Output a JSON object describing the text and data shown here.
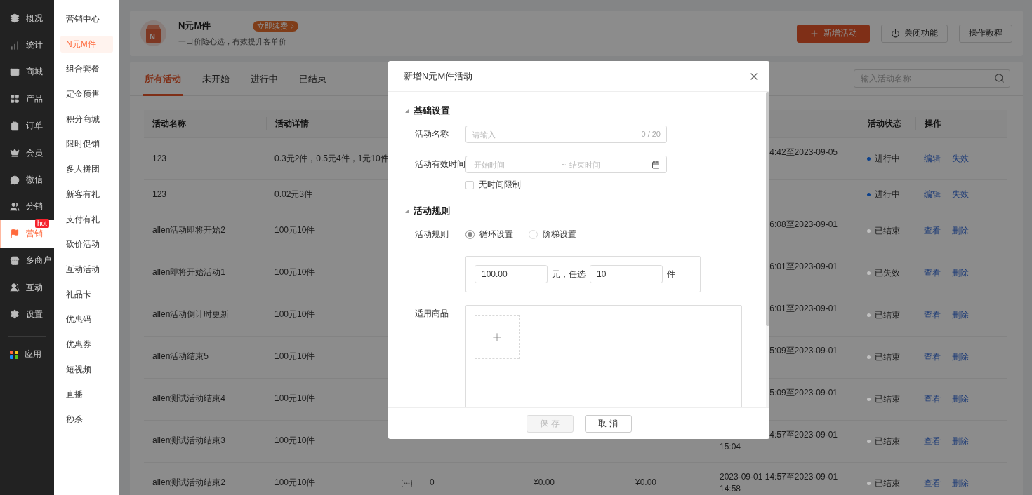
{
  "nav": {
    "items": [
      {
        "label": "概况",
        "selected": false
      },
      {
        "label": "统计",
        "selected": false
      },
      {
        "label": "商城",
        "selected": false
      },
      {
        "label": "产品",
        "selected": false
      },
      {
        "label": "订单",
        "selected": false
      },
      {
        "label": "会员",
        "selected": false
      },
      {
        "label": "微信",
        "selected": false
      },
      {
        "label": "分销",
        "selected": false
      },
      {
        "label": "营销",
        "selected": true,
        "badge": "hot"
      },
      {
        "label": "多商户",
        "selected": false
      },
      {
        "label": "互动",
        "selected": false
      },
      {
        "label": "设置",
        "selected": false
      }
    ],
    "apps": [
      {
        "label": "应用",
        "selected": false
      }
    ]
  },
  "submenu": {
    "items": [
      {
        "label": "营销中心",
        "selected": false
      },
      {
        "label": "N元M件",
        "selected": true
      },
      {
        "label": "组合套餐",
        "selected": false
      },
      {
        "label": "定金预售",
        "selected": false
      },
      {
        "label": "积分商城",
        "selected": false
      },
      {
        "label": "限时促销",
        "selected": false
      },
      {
        "label": "多人拼团",
        "selected": false
      },
      {
        "label": "新客有礼",
        "selected": false
      },
      {
        "label": "支付有礼",
        "selected": false
      },
      {
        "label": "砍价活动",
        "selected": false
      },
      {
        "label": "互动活动",
        "selected": false
      },
      {
        "label": "礼品卡",
        "selected": false
      },
      {
        "label": "优惠码",
        "selected": false
      },
      {
        "label": "优惠券",
        "selected": false
      },
      {
        "label": "短视频",
        "selected": false
      },
      {
        "label": "直播",
        "selected": false
      },
      {
        "label": "秒杀",
        "selected": false
      }
    ]
  },
  "header": {
    "logo_letter": "N",
    "title": "N元M件",
    "renew": "立即续费",
    "subtitle": "一口价随心选，有效提升客单价",
    "buttons": [
      {
        "label": "新增活动",
        "kind": "primary"
      },
      {
        "label": "关闭功能",
        "kind": "power"
      },
      {
        "label": "操作教程",
        "kind": "plain"
      }
    ]
  },
  "tabs": [
    {
      "label": "所有活动",
      "selected": true
    },
    {
      "label": "未开始",
      "selected": false
    },
    {
      "label": "进行中",
      "selected": false
    },
    {
      "label": "已结束",
      "selected": false
    }
  ],
  "search": {
    "placeholder": "输入活动名称"
  },
  "table": {
    "columns": {
      "name": "活动名称",
      "detail": "活动详情",
      "status": "活动状态",
      "actions": "操作"
    },
    "rows": [
      {
        "kind": "partial",
        "name": "123",
        "detail": "0.3元2件，0.5元4件，1元10件",
        "column_7": [
          "4:42至2023-09-05"
        ],
        "status": {
          "label": "进行中",
          "color": "#0c418c"
        },
        "actions": [
          "编辑",
          "失效"
        ]
      },
      {
        "kind": "partial",
        "name": "123",
        "detail": "0.02元3件",
        "status": {
          "label": "进行中",
          "color": "#0c418c"
        },
        "actions": [
          "编辑",
          "失效"
        ]
      },
      {
        "kind": "partial",
        "name": "allen活动即将开始2",
        "detail": "100元10件",
        "column_7": [
          "6:08至2023-09-01"
        ],
        "status": {
          "label": "已结束",
          "color": "#c0c0c0"
        },
        "actions": [
          "查看",
          "删除"
        ]
      },
      {
        "kind": "partial",
        "name": "allen即将开始活动1",
        "detail": "100元10件",
        "column_7": [
          "6:01至2023-09-01"
        ],
        "status": {
          "label": "已失效",
          "color": "#c0c0c0"
        },
        "actions": [
          "查看",
          "删除"
        ]
      },
      {
        "kind": "partial",
        "name": "allen活动倒计时更新",
        "detail": "100元10件",
        "column_7": [
          "6:01至2023-09-01"
        ],
        "status": {
          "label": "已结束",
          "color": "#c0c0c0"
        },
        "actions": [
          "查看",
          "删除"
        ]
      },
      {
        "kind": "partial",
        "name": "allen活动结束5",
        "detail": "100元10件",
        "column_7": [
          "5:09至2023-09-01"
        ],
        "status": {
          "label": "已结束",
          "color": "#c0c0c0"
        },
        "actions": [
          "查看",
          "删除"
        ]
      },
      {
        "kind": "partial",
        "name": "allen测试活动结束4",
        "detail": "100元10件",
        "column_7": [
          "5:09至2023-09-01"
        ],
        "status": {
          "label": "已结束",
          "color": "#c0c0c0"
        },
        "actions": [
          "查看",
          "删除"
        ]
      },
      {
        "kind": "partial",
        "name": "allen测试活动结束3",
        "detail": "100元10件",
        "column_7": [
          "4:57至2023-09-01",
          "15:04"
        ],
        "status": {
          "label": "已结束",
          "color": "#c0c0c0"
        },
        "actions": [
          "查看",
          "删除"
        ]
      },
      {
        "kind": "full",
        "name": "allen测试活动结束2",
        "detail": "100元10件",
        "column_4": "0",
        "column_5": "¥0.00",
        "column_6": "¥0.00",
        "column_7": [
          "2023-09-01 14:57至2023-09-01",
          "14:58"
        ],
        "status": {
          "label": "已结束",
          "color": "#c0c0c0"
        },
        "actions": [
          "查看",
          "删除"
        ]
      }
    ]
  },
  "modal": {
    "title": "新增N元M件活动",
    "sections": [
      {
        "title": "基础设置",
        "fields": [
          {
            "kind": "text",
            "label": "活动名称",
            "placeholder": "请输入",
            "counter": "0 / 20"
          },
          {
            "kind": "daterange",
            "label": "活动有效时间",
            "start_placeholder": "开始时间",
            "separator": "~",
            "end_placeholder": "结束时间",
            "checkbox": {
              "label": "无时间限制",
              "checked": false
            }
          }
        ]
      },
      {
        "title": "活动规则",
        "fields": [
          {
            "kind": "radio",
            "label": "活动规则",
            "options": [
              {
                "label": "循环设置",
                "selected": true
              },
              {
                "label": "阶梯设置",
                "selected": false
              }
            ]
          },
          {
            "kind": "rule",
            "price": "100.00",
            "price_unit": "元，任选",
            "count": "10",
            "count_unit": "件"
          },
          {
            "kind": "goods",
            "label": "适用商品"
          }
        ]
      }
    ],
    "buttons": [
      {
        "label": "保 存",
        "disabled": true
      },
      {
        "label": "取 消",
        "disabled": false
      }
    ]
  }
}
